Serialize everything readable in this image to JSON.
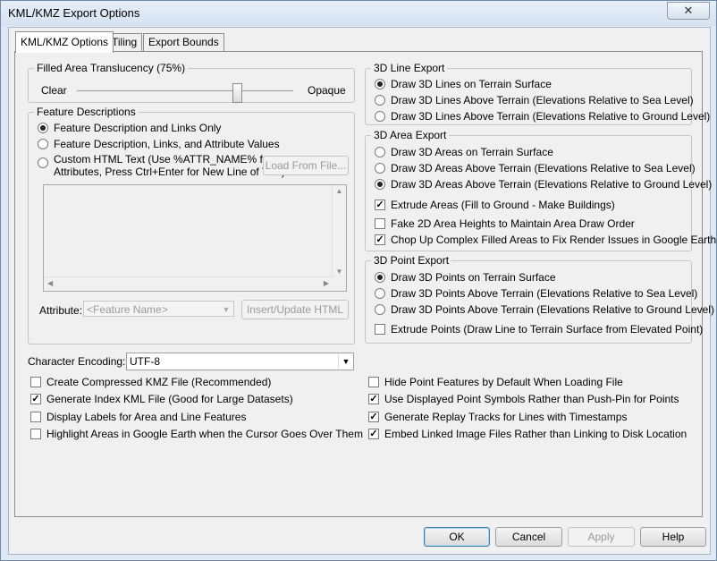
{
  "window": {
    "title": "KML/KMZ Export Options",
    "close": "✕"
  },
  "tabs": [
    "KML/KMZ Options",
    "Tiling",
    "Export Bounds"
  ],
  "translucency": {
    "legend": "Filled Area Translucency (75%)",
    "left": "Clear",
    "right": "Opaque",
    "value_percent": 75
  },
  "feature_desc": {
    "legend": "Feature Descriptions",
    "opt1": "Feature Description and Links Only",
    "opt2": "Feature Description, Links, and Attribute Values",
    "opt3_line1": "Custom HTML Text (Use %ATTR_NAME% for",
    "opt3_line2": "Attributes, Press Ctrl+Enter for New Line of Text)",
    "load_button": "Load From File...",
    "attribute_label": "Attribute:",
    "attribute_value": "<Feature Name>",
    "insert_button": "Insert/Update HTML"
  },
  "encoding": {
    "label": "Character Encoding:",
    "value": "UTF-8"
  },
  "line_export": {
    "legend": "3D Line Export",
    "opt1": "Draw 3D Lines on Terrain Surface",
    "opt2": "Draw 3D Lines Above Terrain (Elevations Relative to Sea Level)",
    "opt3": "Draw 3D Lines Above Terrain (Elevations Relative to Ground Level)"
  },
  "area_export": {
    "legend": "3D Area Export",
    "opt1": "Draw 3D Areas on Terrain Surface",
    "opt2": "Draw 3D Areas Above Terrain (Elevations Relative to Sea Level)",
    "opt3": "Draw 3D Areas Above Terrain (Elevations Relative to Ground Level)",
    "extrude": "Extrude Areas (Fill to Ground - Make Buildings)",
    "fake2d": "Fake 2D Area Heights to Maintain Area Draw Order",
    "chop": "Chop Up Complex Filled Areas to Fix Render Issues in Google Earth"
  },
  "point_export": {
    "legend": "3D Point Export",
    "opt1": "Draw 3D Points on Terrain Surface",
    "opt2": "Draw 3D Points Above Terrain (Elevations Relative to Sea Level)",
    "opt3": "Draw 3D Points Above Terrain (Elevations Relative to Ground Level)",
    "extrude": "Extrude Points (Draw Line to Terrain Surface from Elevated Point)"
  },
  "bottom_left": {
    "compressed": "Create Compressed KMZ File (Recommended)",
    "index": "Generate Index KML File (Good for Large Datasets)",
    "labels": "Display Labels for Area and Line Features",
    "highlight": "Highlight Areas in Google Earth when the Cursor Goes Over Them"
  },
  "bottom_right": {
    "hide_points": "Hide Point Features by Default When Loading File",
    "symbols": "Use Displayed Point Symbols Rather than Push-Pin for Points",
    "replay": "Generate Replay Tracks for Lines with Timestamps",
    "embed": "Embed Linked Image Files Rather than Linking to Disk Location"
  },
  "buttons": {
    "ok": "OK",
    "cancel": "Cancel",
    "apply": "Apply",
    "help": "Help"
  }
}
